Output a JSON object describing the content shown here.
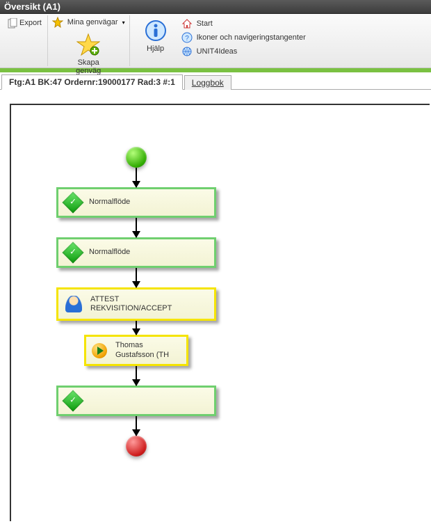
{
  "window": {
    "title": "Översikt (A1)"
  },
  "toolbar": {
    "export": "Export",
    "skapa_genvag": "Skapa\ngenväg",
    "mina_genvagar": "Mina genvägar",
    "hjalp": "Hjälp",
    "links": {
      "start": "Start",
      "ikoner": "Ikoner och navigeringstangenter",
      "unit4": "UNIT4Ideas"
    }
  },
  "tabs": {
    "active": "Ftg:A1 BK:47 Ordernr:19000177 Rad:3 #:1",
    "loggbok": "Loggbok"
  },
  "flow": {
    "steps": [
      {
        "label": "Normalflöde"
      },
      {
        "label": "Normalflöde"
      },
      {
        "label": "ATTEST\nREKVISITION/ACCEPT"
      },
      {
        "label": "Thomas\nGustafsson (TH"
      },
      {
        "label": ""
      }
    ]
  }
}
